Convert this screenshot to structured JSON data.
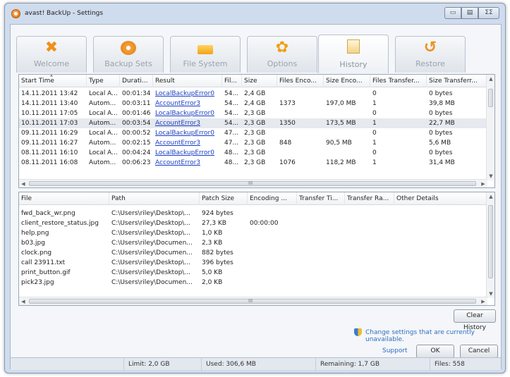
{
  "window": {
    "title": "avast! BackUp - Settings",
    "min_glyph": "▭",
    "restore_glyph": "▤",
    "close_glyph": "ΣΣ"
  },
  "tabs": [
    {
      "label": "Welcome",
      "icon": "tools-icon",
      "glyph": "✖"
    },
    {
      "label": "Backup Sets",
      "icon": "disc-icon",
      "glyph": ""
    },
    {
      "label": "File System",
      "icon": "folder-icon",
      "glyph": ""
    },
    {
      "label": "Options",
      "icon": "gear-icon",
      "glyph": "✿"
    },
    {
      "label": "History",
      "icon": "history-icon",
      "glyph": "",
      "active": true
    },
    {
      "label": "Restore",
      "icon": "restore-icon",
      "glyph": "↺"
    }
  ],
  "history_table": {
    "sort_glyph": "▲",
    "columns": [
      "Start Time",
      "Type",
      "Durati...",
      "Result",
      "Fil...",
      "Size",
      "Files Enco...",
      "Size Enco...",
      "Files Transfer...",
      "Size Transferr..."
    ],
    "rows": [
      [
        "14.11.2011 13:42",
        "Local A...",
        "00:01:34",
        "LocalBackupError0",
        "54...",
        "2,4 GB",
        "",
        "",
        "0",
        "0 bytes"
      ],
      [
        "14.11.2011 13:40",
        "Autom...",
        "00:03:11",
        "AccountError3",
        "54...",
        "2,4 GB",
        "1373",
        "197,0 MB",
        "1",
        "39,8 MB"
      ],
      [
        "10.11.2011 17:05",
        "Local A...",
        "00:01:46",
        "LocalBackupError0",
        "54...",
        "2,3 GB",
        "",
        "",
        "0",
        "0 bytes"
      ],
      [
        "10.11.2011 17:03",
        "Autom...",
        "00:03:54",
        "AccountError3",
        "54...",
        "2,3 GB",
        "1350",
        "173,5 MB",
        "1",
        "22,7 MB"
      ],
      [
        "09.11.2011 16:29",
        "Local A...",
        "00:00:52",
        "LocalBackupError0",
        "47...",
        "2,3 GB",
        "",
        "",
        "0",
        "0 bytes"
      ],
      [
        "09.11.2011 16:27",
        "Autom...",
        "00:02:15",
        "AccountError3",
        "47...",
        "2,3 GB",
        "848",
        "90,5 MB",
        "1",
        "5,6 MB"
      ],
      [
        "08.11.2011 16:10",
        "Local A...",
        "00:04:24",
        "LocalBackupError0",
        "48...",
        "2,3 GB",
        "",
        "",
        "0",
        "0 bytes"
      ],
      [
        "08.11.2011 16:08",
        "Autom...",
        "00:06:23",
        "AccountError3",
        "48...",
        "2,3 GB",
        "1076",
        "118,2 MB",
        "1",
        "31,4 MB"
      ]
    ],
    "selected_row": 3
  },
  "files_table": {
    "columns": [
      "File",
      "Path",
      "Patch Size",
      "Encoding ...",
      "Transfer Ti...",
      "Transfer Ra...",
      "Other Details"
    ],
    "rows": [
      [
        "fwd_back_wr.png",
        "C:\\Users\\riley\\Desktop\\...",
        "924 bytes",
        "",
        "",
        "",
        ""
      ],
      [
        "client_restore_status.jpg",
        "C:\\Users\\riley\\Desktop\\...",
        "27,3 KB",
        "00:00:00",
        "",
        "",
        ""
      ],
      [
        "help.png",
        "C:\\Users\\riley\\Desktop\\...",
        "1,0 KB",
        "",
        "",
        "",
        ""
      ],
      [
        "b03.jpg",
        "C:\\Users\\riley\\Documen...",
        "2,3 KB",
        "",
        "",
        "",
        ""
      ],
      [
        "clock.png",
        "C:\\Users\\riley\\Documen...",
        "882 bytes",
        "",
        "",
        "",
        ""
      ],
      [
        "call 23911.txt",
        "C:\\Users\\riley\\Desktop\\...",
        "396 bytes",
        "",
        "",
        "",
        ""
      ],
      [
        "print_button.gif",
        "C:\\Users\\riley\\Desktop\\...",
        "5,0 KB",
        "",
        "",
        "",
        ""
      ],
      [
        "pick23.jpg",
        "C:\\Users\\riley\\Documen...",
        "2,0 KB",
        "",
        "",
        "",
        ""
      ]
    ]
  },
  "scroll": {
    "up": "▲",
    "down": "▼",
    "left": "◀",
    "right": "▶",
    "grip": "III"
  },
  "buttons": {
    "clear_history": "Clear History",
    "ok": "OK",
    "cancel": "Cancel"
  },
  "notice": {
    "text": "Change settings that are currently unavailable.",
    "icon": "uac-shield-icon"
  },
  "support_link": "Support",
  "status_bar": {
    "limit": "Limit: 2,0 GB",
    "used": "Used: 306,6 MB",
    "remaining": "Remaining: 1,7 GB",
    "files": "Files: 558"
  },
  "colors": {
    "accent": "#f0901c",
    "link": "#1a3ec2",
    "selection": "#e6e9ee"
  }
}
